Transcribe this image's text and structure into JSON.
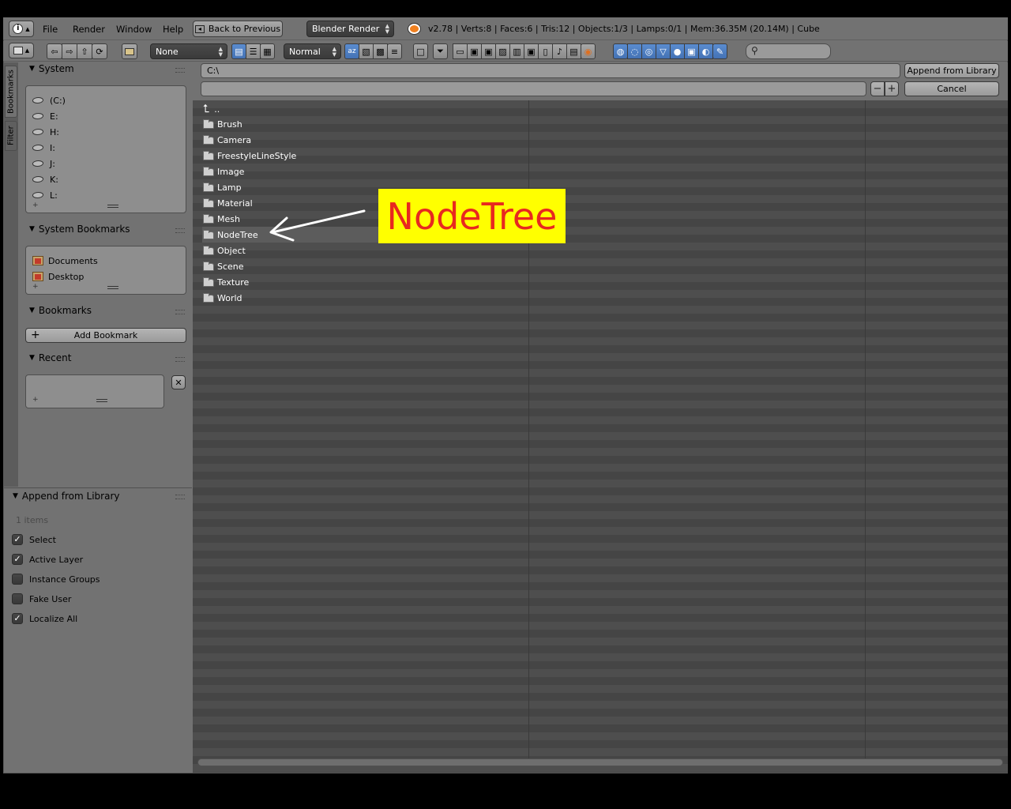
{
  "info_header": {
    "menus": [
      "File",
      "Render",
      "Window",
      "Help"
    ],
    "back_button": "Back to Previous",
    "render_engine": "Blender Render",
    "stats": "v2.78 | Verts:8 | Faces:6 | Tris:12 | Objects:1/3 | Lamps:0/1 | Mem:36.35M (20.14M) | Cube"
  },
  "fb_header": {
    "filter_none": "None",
    "display_size": "Normal"
  },
  "tabs": {
    "bookmarks": "Bookmarks",
    "filter": "Filter"
  },
  "system": {
    "title": "System",
    "drives": [
      "(C:)",
      "E:",
      "H:",
      "I:",
      "J:",
      "K:",
      "L:"
    ]
  },
  "system_bookmarks": {
    "title": "System Bookmarks",
    "items": [
      "Documents",
      "Desktop"
    ]
  },
  "bookmarks": {
    "title": "Bookmarks",
    "add_label": "Add Bookmark"
  },
  "recent": {
    "title": "Recent"
  },
  "operator": {
    "title": "Append from Library",
    "items_count": "1 items",
    "options": [
      {
        "label": "Select",
        "checked": true
      },
      {
        "label": "Active Layer",
        "checked": true
      },
      {
        "label": "Instance Groups",
        "checked": false
      },
      {
        "label": "Fake User",
        "checked": false
      },
      {
        "label": "Localize All",
        "checked": true
      }
    ]
  },
  "path": {
    "directory": "C:\\",
    "filename": "",
    "confirm_label": "Append from Library",
    "cancel_label": "Cancel"
  },
  "files": {
    "parent": "..",
    "folders": [
      "Brush",
      "Camera",
      "FreestyleLineStyle",
      "Image",
      "Lamp",
      "Material",
      "Mesh",
      "NodeTree",
      "Object",
      "Scene",
      "Texture",
      "World"
    ],
    "selected": "NodeTree"
  },
  "annotation": {
    "text": "NodeTree",
    "bg_color": "#ffff00",
    "text_color": "#e8281f"
  }
}
